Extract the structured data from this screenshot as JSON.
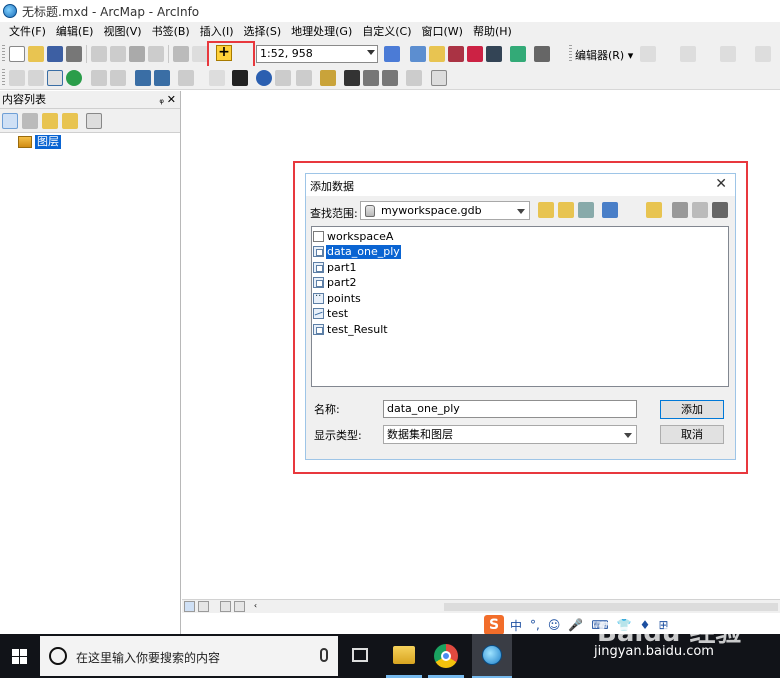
{
  "window": {
    "title": "无标题.mxd - ArcMap - ArcInfo"
  },
  "menubar": [
    "文件(F)",
    "编辑(E)",
    "视图(V)",
    "书签(B)",
    "插入(I)",
    "选择(S)",
    "地理处理(G)",
    "自定义(C)",
    "窗口(W)",
    "帮助(H)"
  ],
  "toolbar": {
    "scale_value": "1:52, 958",
    "editor_label": "编辑器(R) ▾",
    "add_data_icon": "add-data-icon"
  },
  "toc": {
    "title": "内容列表",
    "pin_glyph": "ᵩ",
    "close_glyph": "✕",
    "layers_label": "图层"
  },
  "dialog": {
    "title": "添加数据",
    "close_glyph": "✕",
    "look_in_label": "查找范围:",
    "look_in_value": "myworkspace.gdb",
    "files": [
      {
        "name": "workspaceA",
        "icon": "folder",
        "selected": false
      },
      {
        "name": "data_one_ply",
        "icon": "poly",
        "selected": true
      },
      {
        "name": "part1",
        "icon": "poly",
        "selected": false
      },
      {
        "name": "part2",
        "icon": "poly",
        "selected": false
      },
      {
        "name": "points",
        "icon": "pts",
        "selected": false
      },
      {
        "name": "test",
        "icon": "line",
        "selected": false
      },
      {
        "name": "test_Result",
        "icon": "poly",
        "selected": false
      }
    ],
    "name_label": "名称:",
    "name_value": "data_one_ply",
    "type_label": "显示类型:",
    "type_value": "数据集和图层",
    "add_button": "添加",
    "cancel_button": "取消"
  },
  "taskbar": {
    "search_placeholder": "在这里输入你要搜索的内容"
  },
  "ime": {
    "sogou_glyph": "S",
    "items": [
      "中",
      "°,",
      "☺",
      "🎤",
      "⌨",
      "👕",
      "♦",
      "⊞"
    ]
  },
  "watermark": {
    "logo": "Baidu 经验",
    "url": "jingyan.baidu.com"
  }
}
